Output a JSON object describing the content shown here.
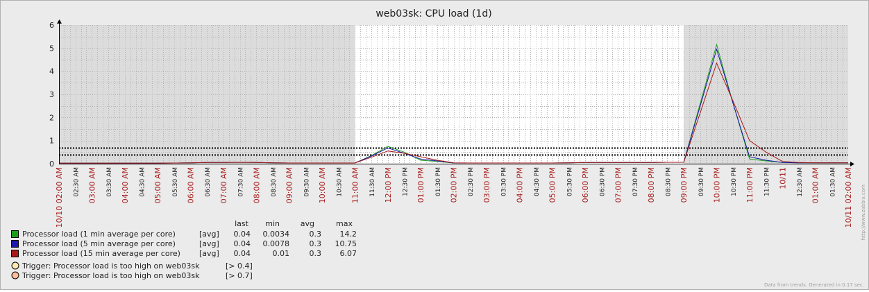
{
  "chart_data": {
    "type": "line",
    "title": "web03sk: CPU load (1d)",
    "y_ticks": [
      "0",
      "1",
      "2",
      "3",
      "4",
      "5",
      "6"
    ],
    "ylim": [
      0,
      6
    ],
    "x_tick_labels": [
      {
        "text": "10/10 02:00 AM",
        "major": true
      },
      {
        "text": "02:30 AM",
        "major": false
      },
      {
        "text": "03:00 AM",
        "major": true
      },
      {
        "text": "03:30 AM",
        "major": false
      },
      {
        "text": "04:00 AM",
        "major": true
      },
      {
        "text": "04:30 AM",
        "major": false
      },
      {
        "text": "05:00 AM",
        "major": true
      },
      {
        "text": "05:30 AM",
        "major": false
      },
      {
        "text": "06:00 AM",
        "major": true
      },
      {
        "text": "06:30 AM",
        "major": false
      },
      {
        "text": "07:00 AM",
        "major": true
      },
      {
        "text": "07:30 AM",
        "major": false
      },
      {
        "text": "08:00 AM",
        "major": true
      },
      {
        "text": "08:30 AM",
        "major": false
      },
      {
        "text": "09:00 AM",
        "major": true
      },
      {
        "text": "09:30 AM",
        "major": false
      },
      {
        "text": "10:00 AM",
        "major": true
      },
      {
        "text": "10:30 AM",
        "major": false
      },
      {
        "text": "11:00 AM",
        "major": true
      },
      {
        "text": "11:30 AM",
        "major": false
      },
      {
        "text": "12:00 PM",
        "major": true
      },
      {
        "text": "12:30 PM",
        "major": false
      },
      {
        "text": "01:00 PM",
        "major": true
      },
      {
        "text": "01:30 PM",
        "major": false
      },
      {
        "text": "02:00 PM",
        "major": true
      },
      {
        "text": "02:30 PM",
        "major": false
      },
      {
        "text": "03:00 PM",
        "major": true
      },
      {
        "text": "03:30 PM",
        "major": false
      },
      {
        "text": "04:00 PM",
        "major": true
      },
      {
        "text": "04:30 PM",
        "major": false
      },
      {
        "text": "05:00 PM",
        "major": true
      },
      {
        "text": "05:30 PM",
        "major": false
      },
      {
        "text": "06:00 PM",
        "major": true
      },
      {
        "text": "06:30 PM",
        "major": false
      },
      {
        "text": "07:00 PM",
        "major": true
      },
      {
        "text": "07:30 PM",
        "major": false
      },
      {
        "text": "08:00 PM",
        "major": true
      },
      {
        "text": "08:30 PM",
        "major": false
      },
      {
        "text": "09:00 PM",
        "major": true
      },
      {
        "text": "09:30 PM",
        "major": false
      },
      {
        "text": "10:00 PM",
        "major": true
      },
      {
        "text": "10:30 PM",
        "major": false
      },
      {
        "text": "11:00 PM",
        "major": true
      },
      {
        "text": "11:30 PM",
        "major": false
      },
      {
        "text": "10/11",
        "major": true
      },
      {
        "text": "12:30 AM",
        "major": false
      },
      {
        "text": "01:00 AM",
        "major": true
      },
      {
        "text": "01:30 AM",
        "major": false
      },
      {
        "text": "10/11 02:00 AM",
        "major": true
      }
    ],
    "x_hours": [
      0,
      0.5,
      1,
      1.5,
      2,
      2.5,
      3,
      3.5,
      4,
      4.5,
      5,
      5.5,
      6,
      6.5,
      7,
      7.5,
      8,
      8.5,
      9,
      9.5,
      10,
      10.5,
      11,
      11.5,
      12,
      12.5,
      13,
      13.5,
      14,
      14.5,
      15,
      15.5,
      16,
      16.5,
      17,
      17.5,
      18,
      18.5,
      19,
      19.5,
      20,
      20.5,
      21,
      21.5,
      22,
      22.5,
      23,
      23.5,
      24
    ],
    "series": [
      {
        "name": "Processor load (1 min average per core)",
        "color": "#1a9e1a",
        "values": [
          0.02,
          0.02,
          0.02,
          0.02,
          0.02,
          0.02,
          0.02,
          0.03,
          0.04,
          0.05,
          0.05,
          0.06,
          0.05,
          0.04,
          0.03,
          0.03,
          0.03,
          0.03,
          0.03,
          0.35,
          0.75,
          0.5,
          0.15,
          0.1,
          0.03,
          0.03,
          0.03,
          0.03,
          0.03,
          0.03,
          0.03,
          0.04,
          0.05,
          0.05,
          0.05,
          0.05,
          0.05,
          0.06,
          0.06,
          2.6,
          5.15,
          2.6,
          0.2,
          0.12,
          0.05,
          0.04,
          0.04,
          0.04,
          0.04
        ]
      },
      {
        "name": "Processor load (5 min average per core)",
        "color": "#1a1aa8",
        "values": [
          0.02,
          0.02,
          0.02,
          0.02,
          0.02,
          0.02,
          0.02,
          0.03,
          0.04,
          0.05,
          0.05,
          0.06,
          0.05,
          0.04,
          0.03,
          0.03,
          0.03,
          0.03,
          0.03,
          0.33,
          0.68,
          0.45,
          0.2,
          0.12,
          0.03,
          0.03,
          0.03,
          0.03,
          0.03,
          0.03,
          0.03,
          0.04,
          0.05,
          0.05,
          0.05,
          0.05,
          0.05,
          0.06,
          0.06,
          2.5,
          4.95,
          2.6,
          0.3,
          0.15,
          0.05,
          0.04,
          0.04,
          0.04,
          0.04
        ]
      },
      {
        "name": "Processor load (15 min average per core)",
        "color": "#a81a1a",
        "values": [
          0.02,
          0.02,
          0.02,
          0.02,
          0.02,
          0.02,
          0.02,
          0.03,
          0.04,
          0.05,
          0.05,
          0.06,
          0.05,
          0.04,
          0.03,
          0.03,
          0.03,
          0.03,
          0.03,
          0.28,
          0.55,
          0.45,
          0.3,
          0.15,
          0.04,
          0.03,
          0.03,
          0.03,
          0.03,
          0.03,
          0.03,
          0.04,
          0.05,
          0.05,
          0.05,
          0.05,
          0.05,
          0.06,
          0.06,
          2.2,
          4.35,
          2.7,
          1.0,
          0.5,
          0.1,
          0.05,
          0.04,
          0.04,
          0.04
        ]
      }
    ],
    "triggers": [
      {
        "value": 0.4,
        "color": "#ffe9b0"
      },
      {
        "value": 0.7,
        "color": "#ffbe9c"
      }
    ],
    "daytime_hours": [
      9,
      19
    ],
    "grid": true
  },
  "legend": {
    "headers": {
      "last": "last",
      "min": "min",
      "avg": "avg",
      "max": "max"
    },
    "rows": [
      {
        "label": "Processor load (1 min average per core)",
        "func": "[avg]",
        "last": "0.04",
        "min": "0.0034",
        "avg": "0.3",
        "max": "14.2",
        "color": "#1a9e1a"
      },
      {
        "label": "Processor load (5 min average per core)",
        "func": "[avg]",
        "last": "0.04",
        "min": "0.0078",
        "avg": "0.3",
        "max": "10.75",
        "color": "#1a1aa8"
      },
      {
        "label": "Processor load (15 min average per core)",
        "func": "[avg]",
        "last": "0.04",
        "min": "0.01",
        "avg": "0.3",
        "max": "6.07",
        "color": "#a81a1a"
      }
    ],
    "triggers": [
      {
        "label": "Trigger: Processor load is too high on web03sk",
        "cond": "[> 0.4]",
        "color": "#ffe9b0"
      },
      {
        "label": "Trigger: Processor load is too high on web03sk",
        "cond": "[> 0.7]",
        "color": "#ffbe9c"
      }
    ]
  },
  "footer_note": "Data from trends. Generated in 0.17 sec.",
  "watermark": "http://www.zabbix.com",
  "colors": {
    "major_label": "#a82020",
    "minor_label": "#222222"
  }
}
